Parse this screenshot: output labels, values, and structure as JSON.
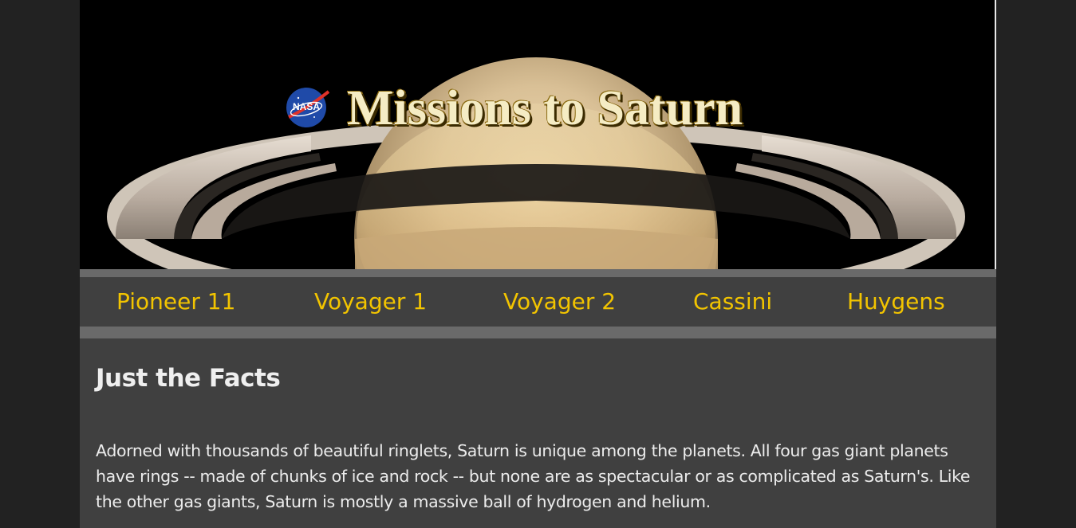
{
  "banner": {
    "title": "Missions to Saturn",
    "logo_text": "NASA",
    "logo_icon": "nasa-meatball-icon",
    "image_subject": "saturn-image"
  },
  "nav": {
    "items": [
      {
        "label": "Pioneer 11"
      },
      {
        "label": "Voyager 1"
      },
      {
        "label": "Voyager 2"
      },
      {
        "label": "Cassini"
      },
      {
        "label": "Huygens"
      }
    ]
  },
  "content": {
    "heading": "Just the Facts",
    "paragraph": "Adorned with thousands of beautiful ringlets, Saturn is unique among the planets. All four gas giant planets have rings -- made of chunks of ice and rock -- but none are as spectacular or as complicated as Saturn's. Like the other gas giants, Saturn is mostly a massive ball of hydrogen and helium."
  },
  "colors": {
    "page_background": "#222222",
    "content_background": "#404040",
    "nav_strip": "#6a6a6a",
    "nav_link": "#f2c400",
    "text": "#ececec"
  }
}
